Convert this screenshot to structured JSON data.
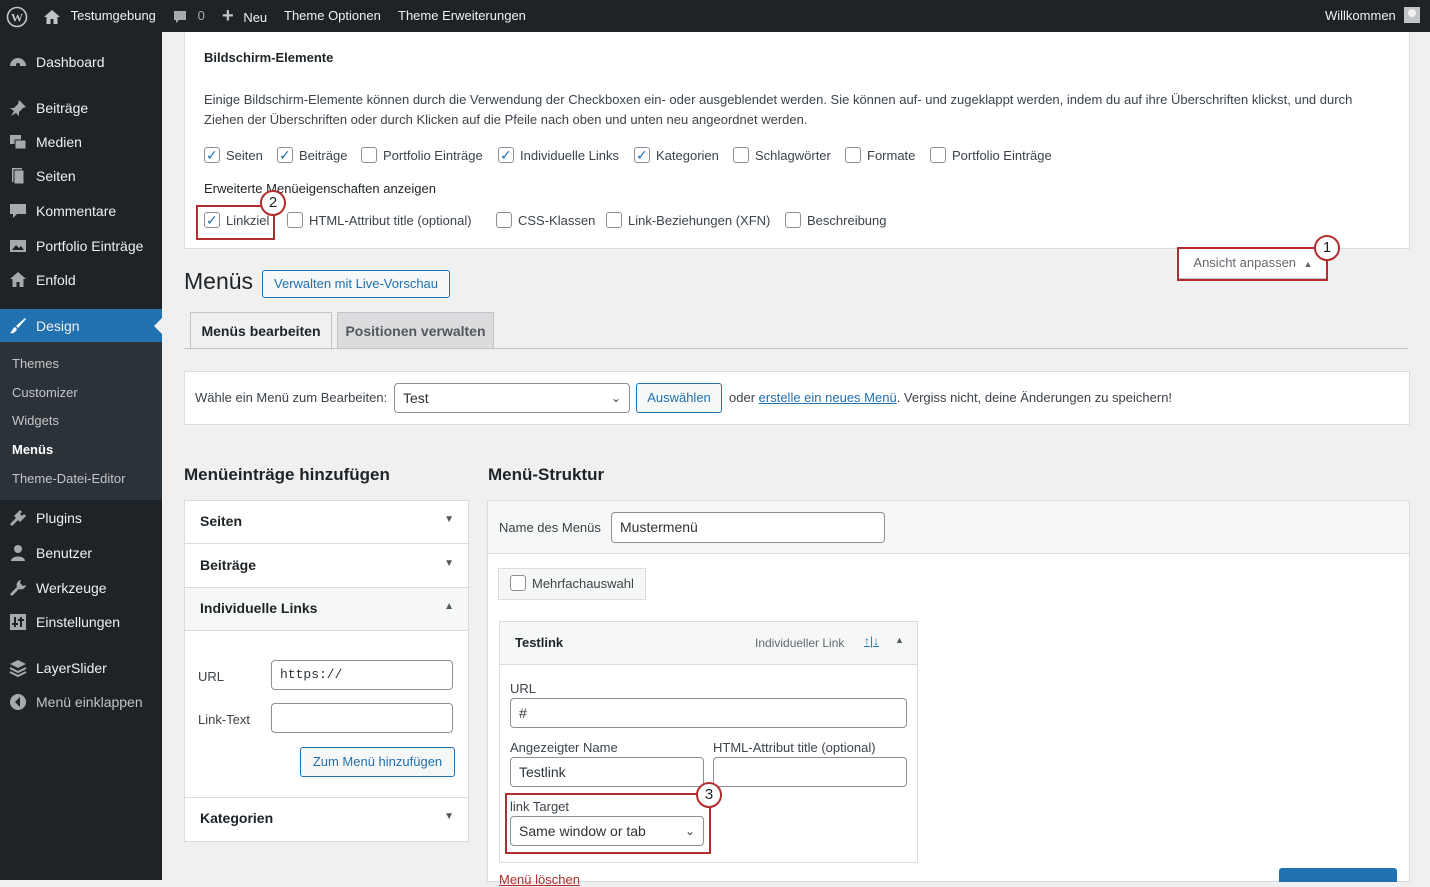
{
  "admin_bar": {
    "site_name": "Testumgebung",
    "comments_count": "0",
    "new_label": "Neu",
    "theme_options": "Theme Optionen",
    "theme_extensions": "Theme Erweiterungen",
    "greeting": "Willkommen"
  },
  "sidebar": {
    "items": [
      {
        "label": "Dashboard",
        "icon": "dashboard-icon"
      },
      {
        "label": "Beiträge",
        "icon": "pin-icon"
      },
      {
        "label": "Medien",
        "icon": "media-icon"
      },
      {
        "label": "Seiten",
        "icon": "page-icon"
      },
      {
        "label": "Kommentare",
        "icon": "comment-icon"
      },
      {
        "label": "Portfolio Einträge",
        "icon": "portfolio-icon"
      },
      {
        "label": "Enfold",
        "icon": "home-icon"
      },
      {
        "label": "Design",
        "icon": "brush-icon"
      },
      {
        "label": "Plugins",
        "icon": "plugin-icon"
      },
      {
        "label": "Benutzer",
        "icon": "user-icon"
      },
      {
        "label": "Werkzeuge",
        "icon": "wrench-icon"
      },
      {
        "label": "Einstellungen",
        "icon": "settings-icon"
      },
      {
        "label": "LayerSlider",
        "icon": "layers-icon"
      },
      {
        "label": "Menü einklappen",
        "icon": "collapse-icon"
      }
    ],
    "submenu": [
      "Themes",
      "Customizer",
      "Widgets",
      "Menüs",
      "Theme-Datei-Editor"
    ]
  },
  "screen_options": {
    "title": "Bildschirm-Elemente",
    "description": "Einige Bildschirm-Elemente können durch die Verwendung der Checkboxen ein- oder ausgeblendet werden. Sie können auf- und zugeklappt werden, indem du auf ihre Überschriften klickst, und durch Ziehen der Überschriften oder durch Klicken auf die Pfeile nach oben und unten neu angeordnet werden.",
    "boxes": [
      {
        "label": "Seiten",
        "checked": true
      },
      {
        "label": "Beiträge",
        "checked": true
      },
      {
        "label": "Portfolio Einträge",
        "checked": false
      },
      {
        "label": "Individuelle Links",
        "checked": true
      },
      {
        "label": "Kategorien",
        "checked": true
      },
      {
        "label": "Schlagwörter",
        "checked": false
      },
      {
        "label": "Formate",
        "checked": false
      },
      {
        "label": "Portfolio Einträge",
        "checked": false
      }
    ],
    "advanced_title": "Erweiterte Menüeigenschaften anzeigen",
    "advanced": [
      {
        "label": "Linkziel",
        "checked": true
      },
      {
        "label": "HTML-Attribut title (optional)",
        "checked": false
      },
      {
        "label": "CSS-Klassen",
        "checked": false
      },
      {
        "label": "Link-Beziehungen (XFN)",
        "checked": false
      },
      {
        "label": "Beschreibung",
        "checked": false
      }
    ],
    "toggle_label": "Ansicht anpassen"
  },
  "callouts": [
    "1",
    "2",
    "3"
  ],
  "page": {
    "title": "Menüs",
    "live_preview_button": "Verwalten mit Live-Vorschau",
    "tabs": [
      "Menüs bearbeiten",
      "Positionen verwalten"
    ]
  },
  "select_menu": {
    "label": "Wähle ein Menü zum Bearbeiten:",
    "selected": "Test",
    "button": "Auswählen",
    "text_before_link": "oder",
    "link_text": "erstelle ein neues Menü",
    "text_after_link": ". Vergiss nicht, deine Änderungen zu speichern!"
  },
  "add_items": {
    "heading": "Menüeinträge hinzufügen",
    "sections": [
      "Seiten",
      "Beiträge",
      "Individuelle Links",
      "Kategorien"
    ],
    "url_label": "URL",
    "url_placeholder": "https://",
    "link_text_label": "Link-Text",
    "add_button": "Zum Menü hinzufügen"
  },
  "structure": {
    "heading": "Menü-Struktur",
    "name_label": "Name des Menüs",
    "name_value": "Mustermenü",
    "bulk_select": "Mehrfachauswahl",
    "item": {
      "title": "Testlink",
      "type": "Individueller Link",
      "url_label": "URL",
      "url_value": "#",
      "nav_label": "Angezeigter Name",
      "nav_value": "Testlink",
      "attr_title_label": "HTML-Attribut title (optional)",
      "target_label": "link Target",
      "target_value": "Same window or tab"
    },
    "delete_link": "Menü löschen"
  },
  "colors": {
    "admin_dark": "#1d2327",
    "accent_blue": "#2271b1",
    "callout_red": "#b32d2e"
  }
}
